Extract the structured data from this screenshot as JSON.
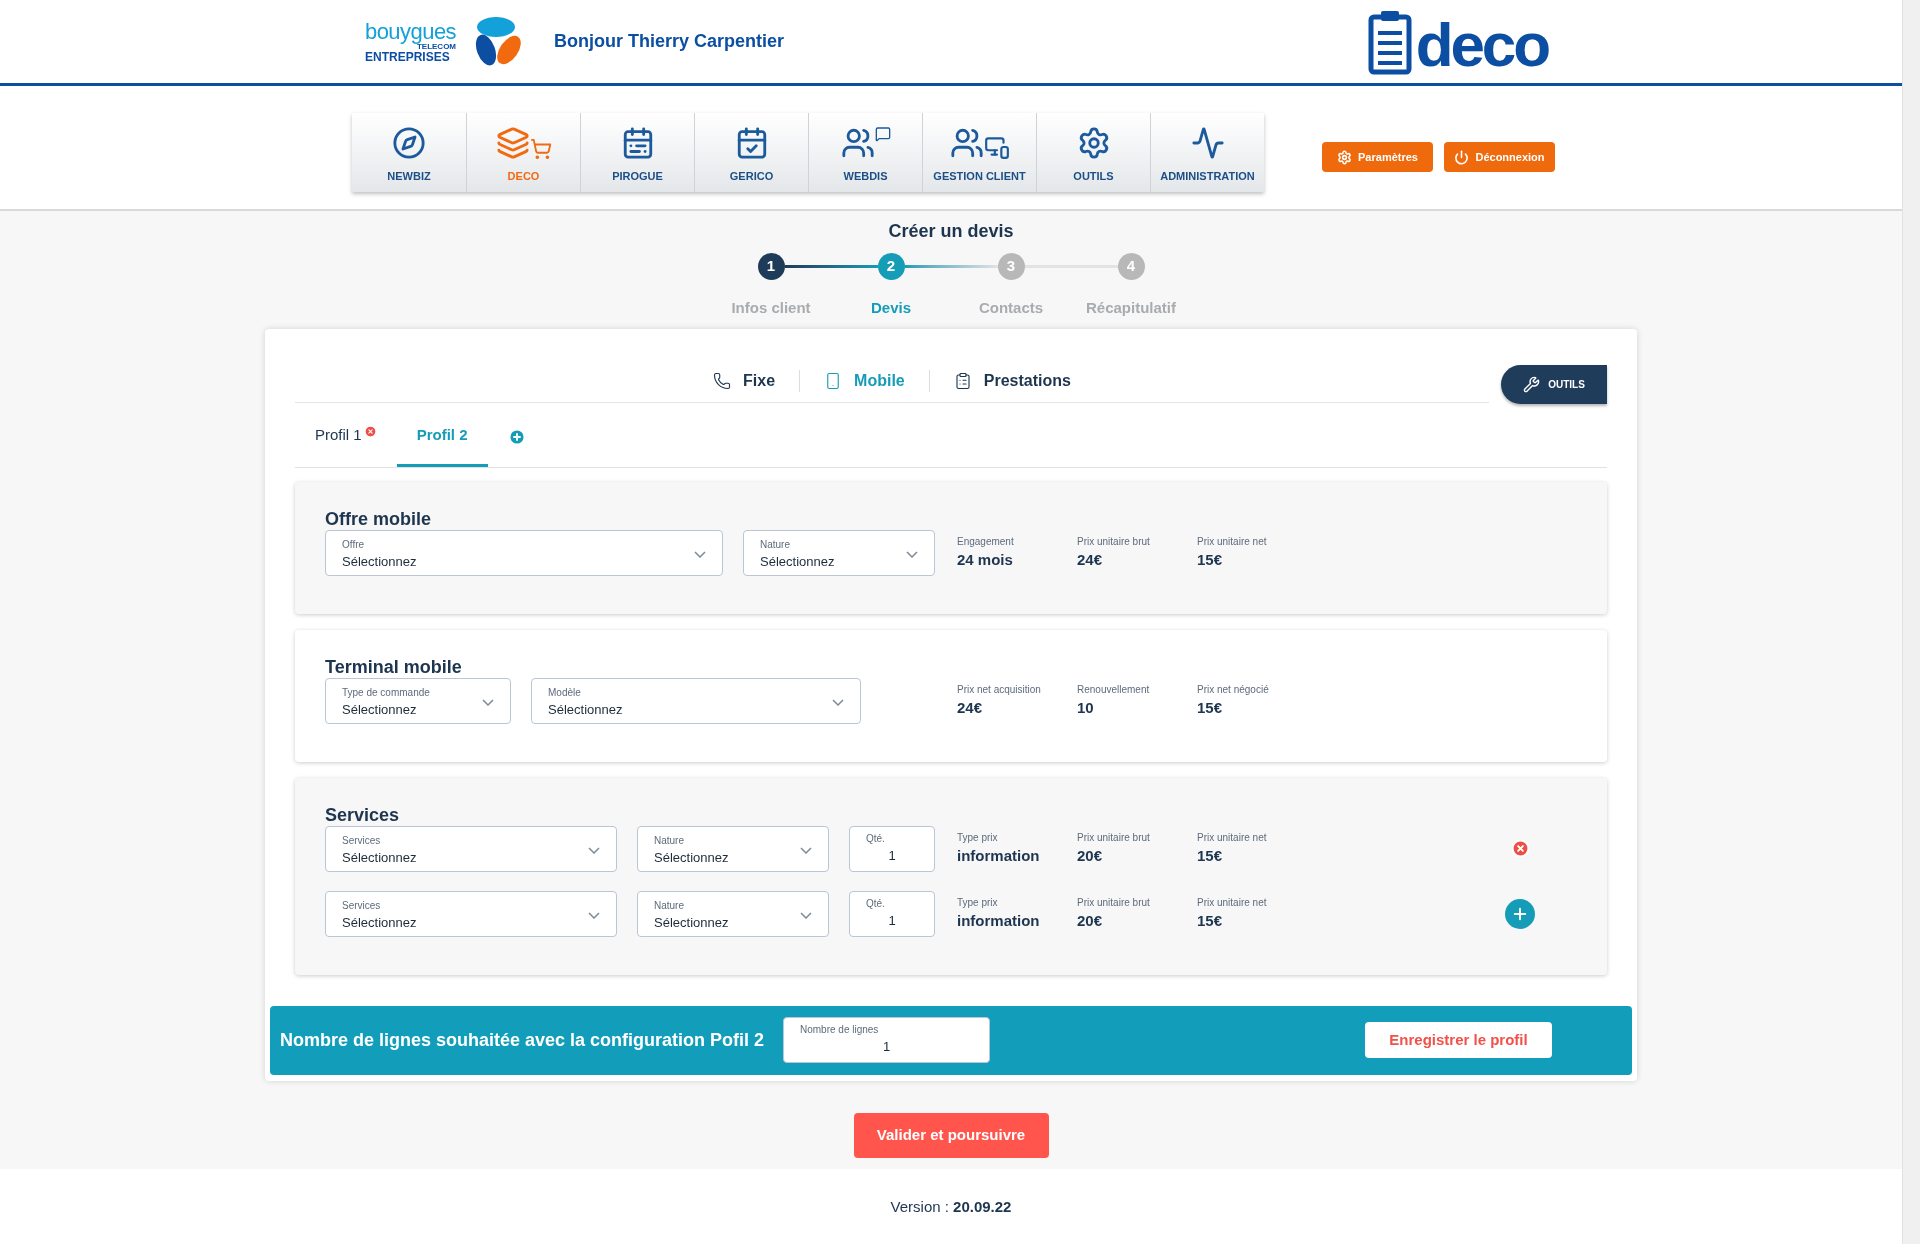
{
  "header": {
    "brand_top": "bouygues",
    "brand_small": "TELECOM",
    "brand_bottom": "ENTREPRISES",
    "greeting": "Bonjour Thierry Carpentier",
    "app_logo": "deco"
  },
  "nav": [
    {
      "label": "NEWBIZ",
      "selected": false
    },
    {
      "label": "DECO",
      "selected": true
    },
    {
      "label": "PIROGUE",
      "selected": false
    },
    {
      "label": "GERICO",
      "selected": false
    },
    {
      "label": "WEBDIS",
      "selected": false
    },
    {
      "label": "GESTION CLIENT",
      "selected": false
    },
    {
      "label": "OUTILS",
      "selected": false
    },
    {
      "label": "ADMINISTRATION",
      "selected": false
    }
  ],
  "header_buttons": [
    {
      "kind": "settings",
      "label": "Paramètres"
    },
    {
      "kind": "logout",
      "label": "Déconnexion"
    }
  ],
  "stepper": {
    "title": "Créer un devis",
    "steps": [
      {
        "number": "1",
        "label": "Infos client",
        "completed": true,
        "selected": false
      },
      {
        "number": "2",
        "label": "Devis",
        "completed": false,
        "selected": true
      },
      {
        "number": "3",
        "label": "Contacts",
        "completed": false,
        "selected": false
      },
      {
        "number": "4",
        "label": "Récapitulatif",
        "completed": false,
        "selected": false
      }
    ]
  },
  "category_tabs": [
    {
      "kind": "phone",
      "label": "Fixe",
      "selected": false
    },
    {
      "kind": "mobile",
      "label": "Mobile",
      "selected": true
    },
    {
      "kind": "clipboard",
      "label": "Prestations",
      "selected": false
    }
  ],
  "tools_button": "OUTILS",
  "profile_tabs": [
    {
      "label": "Profil 1",
      "selected": false,
      "removable": true
    },
    {
      "label": "Profil 2",
      "selected": true,
      "removable": false
    }
  ],
  "sections": [
    {
      "title": "Offre mobile",
      "rows": [
        {
          "fields": [
            {
              "kind": "select",
              "label": "Offre",
              "value": "Sélectionnez"
            },
            {
              "kind": "select",
              "label": "Nature",
              "value": "Sélectionnez"
            }
          ],
          "infos": [
            {
              "label": "Engagement",
              "value": "24 mois"
            },
            {
              "label": "Prix unitaire brut",
              "value": "24€"
            },
            {
              "label": "Prix unitaire net",
              "value": "15€"
            }
          ]
        }
      ]
    },
    {
      "title": "Terminal mobile",
      "rows": [
        {
          "fields": [
            {
              "kind": "select",
              "label": "Type de commande",
              "value": "Sélectionnez"
            },
            {
              "kind": "select",
              "label": "Modèle",
              "value": "Sélectionnez"
            }
          ],
          "infos": [
            {
              "label": "Prix net acquisition",
              "value": "24€"
            },
            {
              "label": "Renouvellement",
              "value": "10"
            },
            {
              "label": "Prix net négocié",
              "value": "15€"
            }
          ]
        }
      ]
    },
    {
      "title": "Services",
      "rows": [
        {
          "fields": [
            {
              "kind": "select",
              "label": "Services",
              "value": "Sélectionnez"
            },
            {
              "kind": "select",
              "label": "Nature",
              "value": "Sélectionnez"
            },
            {
              "kind": "number",
              "label": "Qté.",
              "value": "1"
            }
          ],
          "infos": [
            {
              "label": "Type prix",
              "value": "information"
            },
            {
              "label": "Prix unitaire brut",
              "value": "20€"
            },
            {
              "label": "Prix unitaire net",
              "value": "15€"
            }
          ],
          "kind": "remove"
        },
        {
          "fields": [
            {
              "kind": "select",
              "label": "Services",
              "value": "Sélectionnez"
            },
            {
              "kind": "select",
              "label": "Nature",
              "value": "Sélectionnez"
            },
            {
              "kind": "number",
              "label": "Qté.",
              "value": "1"
            }
          ],
          "infos": [
            {
              "label": "Type prix",
              "value": "information"
            },
            {
              "label": "Prix unitaire brut",
              "value": "20€"
            },
            {
              "label": "Prix unitaire net",
              "value": "15€"
            }
          ],
          "kind": "add"
        }
      ]
    }
  ],
  "banner": {
    "text": "Nombre de lignes souhaitée avec la configuration Pofil 2",
    "field_label": "Nombre de lignes",
    "field_value": "1",
    "button": "Enregistrer le profil"
  },
  "primary_button": "Valider et poursuivre",
  "footer": "Version : **20.09.22**"
}
